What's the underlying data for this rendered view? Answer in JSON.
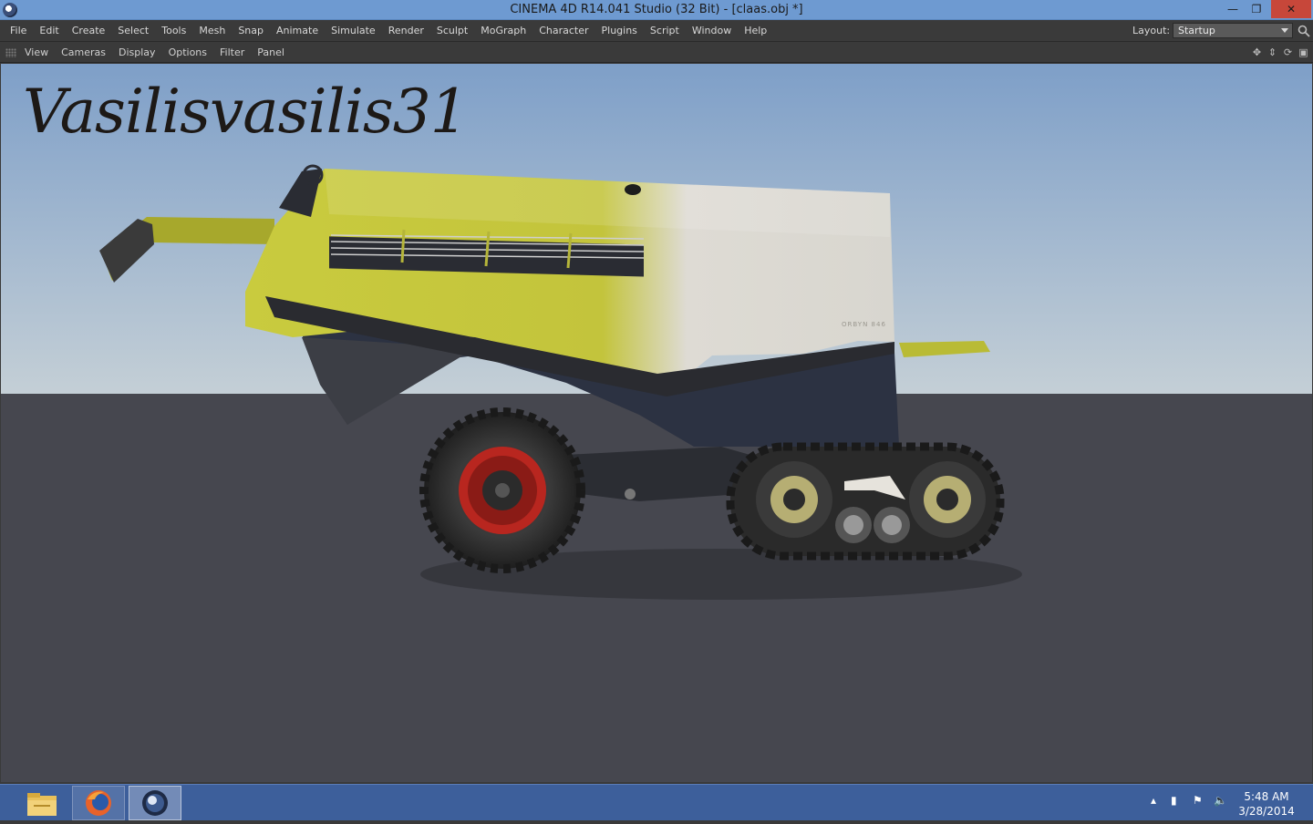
{
  "window": {
    "title": "CINEMA 4D R14.041 Studio (32 Bit) - [claas.obj *]",
    "minimize_glyph": "—",
    "restore_glyph": "❐",
    "close_glyph": "✕"
  },
  "menubar": {
    "items": [
      "File",
      "Edit",
      "Create",
      "Select",
      "Tools",
      "Mesh",
      "Snap",
      "Animate",
      "Simulate",
      "Render",
      "Sculpt",
      "MoGraph",
      "Character",
      "Plugins",
      "Script",
      "Window",
      "Help"
    ],
    "layout_label": "Layout:",
    "layout_value": "Startup"
  },
  "viewport_menu": {
    "items": [
      "View",
      "Cameras",
      "Display",
      "Options",
      "Filter",
      "Panel"
    ],
    "nav_icons": [
      "move-view-icon",
      "dolly-view-icon",
      "rotate-view-icon",
      "toggle-view-icon"
    ]
  },
  "viewport": {
    "watermark": "Vasilisvasilis31",
    "model_badge": "ORBYN 846",
    "colors": {
      "sky_top": "#7e9fc8",
      "sky_bottom": "#c4cfd6",
      "floor": "#46474f",
      "body_yellow": "#c3c43c",
      "body_white": "#dedbd4",
      "tire": "#2e2e2e",
      "rim_red": "#b8261f"
    }
  },
  "taskbar": {
    "apps": [
      "file-explorer-icon",
      "firefox-icon",
      "cinema4d-icon"
    ],
    "time": "5:48 AM",
    "date": "3/28/2014"
  }
}
